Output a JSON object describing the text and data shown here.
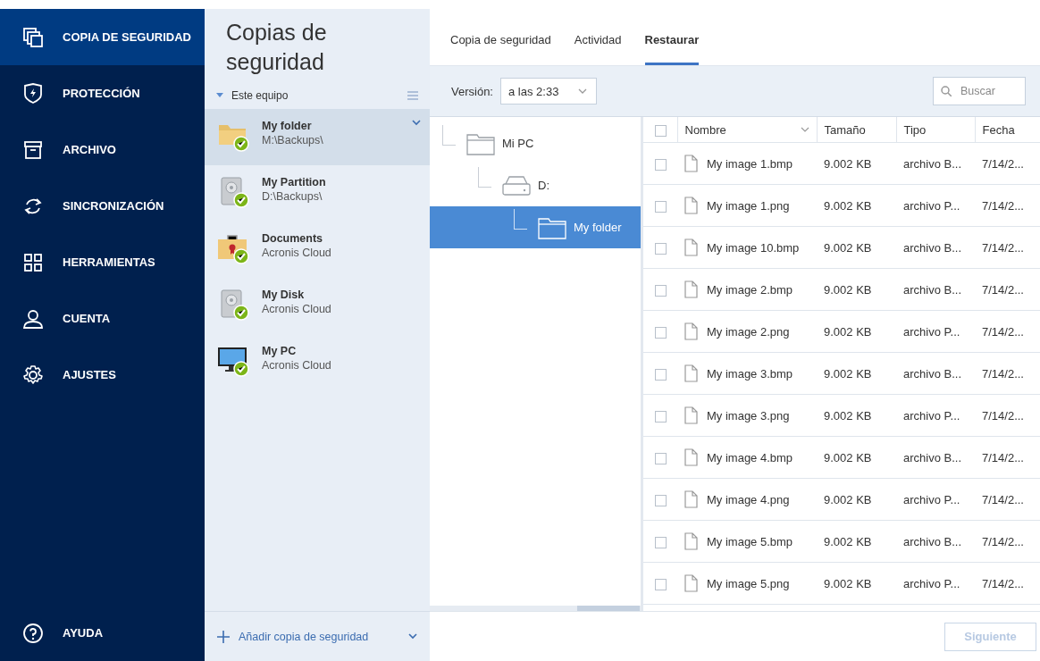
{
  "nav": {
    "items": [
      {
        "label": "COPIA DE SEGURIDAD",
        "selected": true
      },
      {
        "label": "PROTECCIÓN",
        "selected": false
      },
      {
        "label": "ARCHIVO",
        "selected": false
      },
      {
        "label": "SINCRONIZACIÓN",
        "selected": false
      },
      {
        "label": "HERRAMIENTAS",
        "selected": false
      },
      {
        "label": "CUENTA",
        "selected": false
      },
      {
        "label": "AJUSTES",
        "selected": false
      }
    ],
    "help": {
      "label": "AYUDA"
    }
  },
  "backups": {
    "title": "Copias de seguridad",
    "group": "Este equipo",
    "expanded": true,
    "items": [
      {
        "kind": "folder",
        "name": "My folder",
        "location": "M:\\Backups\\",
        "selected": true
      },
      {
        "kind": "disk",
        "name": "My Partition",
        "location": "D:\\Backups\\",
        "selected": false
      },
      {
        "kind": "briefcase",
        "name": "Documents",
        "location": "Acronis Cloud",
        "selected": false
      },
      {
        "kind": "disk",
        "name": "My Disk",
        "location": "Acronis Cloud",
        "selected": false
      },
      {
        "kind": "monitor",
        "name": "My PC",
        "location": "Acronis Cloud",
        "selected": false
      }
    ],
    "add_label": "Añadir copia de seguridad"
  },
  "tabs": [
    {
      "label": "Copia de seguridad",
      "selected": false
    },
    {
      "label": "Actividad",
      "selected": false
    },
    {
      "label": "Restaurar",
      "selected": true
    }
  ],
  "toolbar": {
    "version_label": "Versión:",
    "version_value": "a las 2:33",
    "search_placeholder": "Buscar"
  },
  "tree": [
    {
      "kind": "folder",
      "label": "Mi PC",
      "selected": false,
      "children": [
        {
          "kind": "drive",
          "label": "D:",
          "selected": false,
          "children": [
            {
              "kind": "folder",
              "label": "My folder",
              "selected": true
            }
          ]
        }
      ]
    }
  ],
  "table": {
    "all_checked": false,
    "columns": [
      "Nombre",
      "Tamaño",
      "Tipo",
      "Fecha"
    ],
    "rows": [
      {
        "name": "My image 1.bmp",
        "size": "9.002 KB",
        "type": "archivo B...",
        "date": "7/14/2...",
        "checked": false
      },
      {
        "name": "My image 1.png",
        "size": "9.002 KB",
        "type": "archivo P...",
        "date": "7/14/2...",
        "checked": false
      },
      {
        "name": "My image 10.bmp",
        "size": "9.002 KB",
        "type": "archivo B...",
        "date": "7/14/2...",
        "checked": false
      },
      {
        "name": "My image 2.bmp",
        "size": "9.002 KB",
        "type": "archivo B...",
        "date": "7/14/2...",
        "checked": false
      },
      {
        "name": "My image 2.png",
        "size": "9.002 KB",
        "type": "archivo P...",
        "date": "7/14/2...",
        "checked": false
      },
      {
        "name": "My image 3.bmp",
        "size": "9.002 KB",
        "type": "archivo B...",
        "date": "7/14/2...",
        "checked": false
      },
      {
        "name": "My image 3.png",
        "size": "9.002 KB",
        "type": "archivo P...",
        "date": "7/14/2...",
        "checked": false
      },
      {
        "name": "My image 4.bmp",
        "size": "9.002 KB",
        "type": "archivo B...",
        "date": "7/14/2...",
        "checked": false
      },
      {
        "name": "My image 4.png",
        "size": "9.002 KB",
        "type": "archivo P...",
        "date": "7/14/2...",
        "checked": false
      },
      {
        "name": "My image 5.bmp",
        "size": "9.002 KB",
        "type": "archivo B...",
        "date": "7/14/2...",
        "checked": false
      },
      {
        "name": "My image 5.png",
        "size": "9.002 KB",
        "type": "archivo P...",
        "date": "7/14/2...",
        "checked": false
      }
    ]
  },
  "next_button": {
    "label": "Siguiente",
    "disabled": true
  }
}
